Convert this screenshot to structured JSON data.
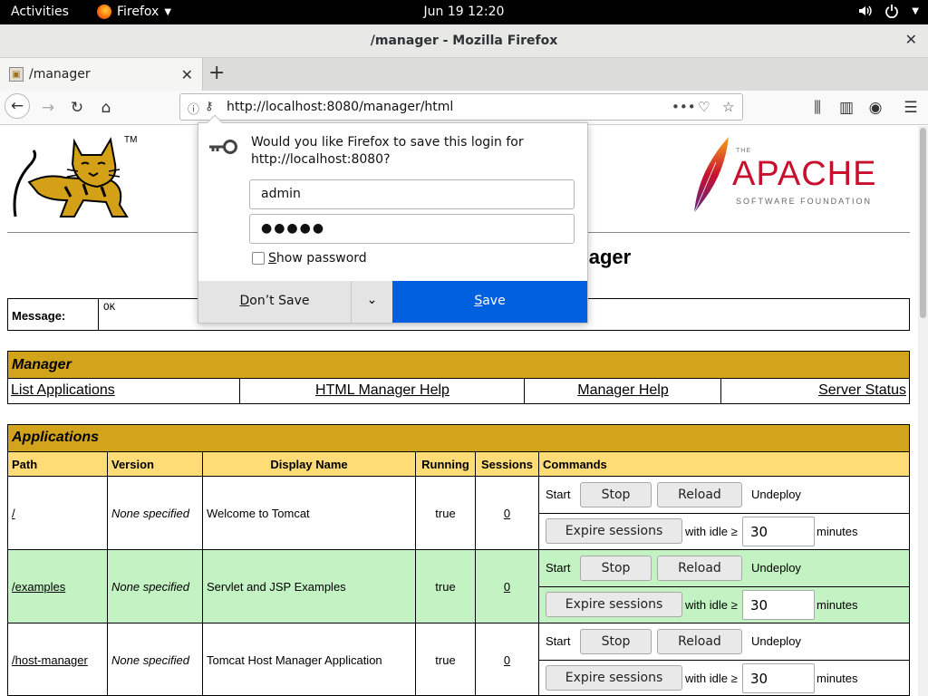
{
  "topbar": {
    "activities": "Activities",
    "app": "Firefox",
    "clock": "Jun 19  12:20"
  },
  "window": {
    "title": "/manager - Mozilla Firefox"
  },
  "tab": {
    "label": "/manager"
  },
  "urlbar": {
    "url": "http://localhost:8080/manager/html"
  },
  "page": {
    "heading_visible": "ager",
    "message_label": "Message:",
    "message_value": "OK",
    "manager": {
      "title": "Manager",
      "links": [
        "List Applications",
        "HTML Manager Help",
        "Manager Help",
        "Server Status"
      ]
    },
    "applications": {
      "title": "Applications",
      "columns": [
        "Path",
        "Version",
        "Display Name",
        "Running",
        "Sessions",
        "Commands"
      ],
      "rows": [
        {
          "path": "/",
          "version": "None specified",
          "display": "Welcome to Tomcat",
          "running": "true",
          "sessions": "0",
          "idle": "30"
        },
        {
          "path": "/examples",
          "version": "None specified",
          "display": "Servlet and JSP Examples",
          "running": "true",
          "sessions": "0",
          "idle": "30"
        },
        {
          "path": "/host-manager",
          "version": "None specified",
          "display": "Tomcat Host Manager Application",
          "running": "true",
          "sessions": "0",
          "idle": "30"
        }
      ],
      "cmd": {
        "start": "Start",
        "stop": "Stop",
        "reload": "Reload",
        "undeploy": "Undeploy",
        "expire": "Expire sessions",
        "with_idle": "with idle ≥",
        "minutes": "minutes"
      }
    },
    "apache": {
      "the": "THE",
      "name": "APACHE",
      "sub": "SOFTWARE FOUNDATION"
    },
    "tomcat_tm": "TM"
  },
  "popup": {
    "message": "Would you like Firefox to save this login for http://localhost:8080?",
    "username": "admin",
    "password": "●●●●●",
    "show_password": "how password",
    "show_password_accel": "S",
    "dont_save_accel": "D",
    "dont_save_rest": "on’t Save",
    "save_accel": "S",
    "save_rest": "ave"
  },
  "colors": {
    "gold": "#d2a41c",
    "colhdr": "#ffdc75",
    "green_row": "#c3f3c3",
    "save_blue": "#0060df"
  }
}
